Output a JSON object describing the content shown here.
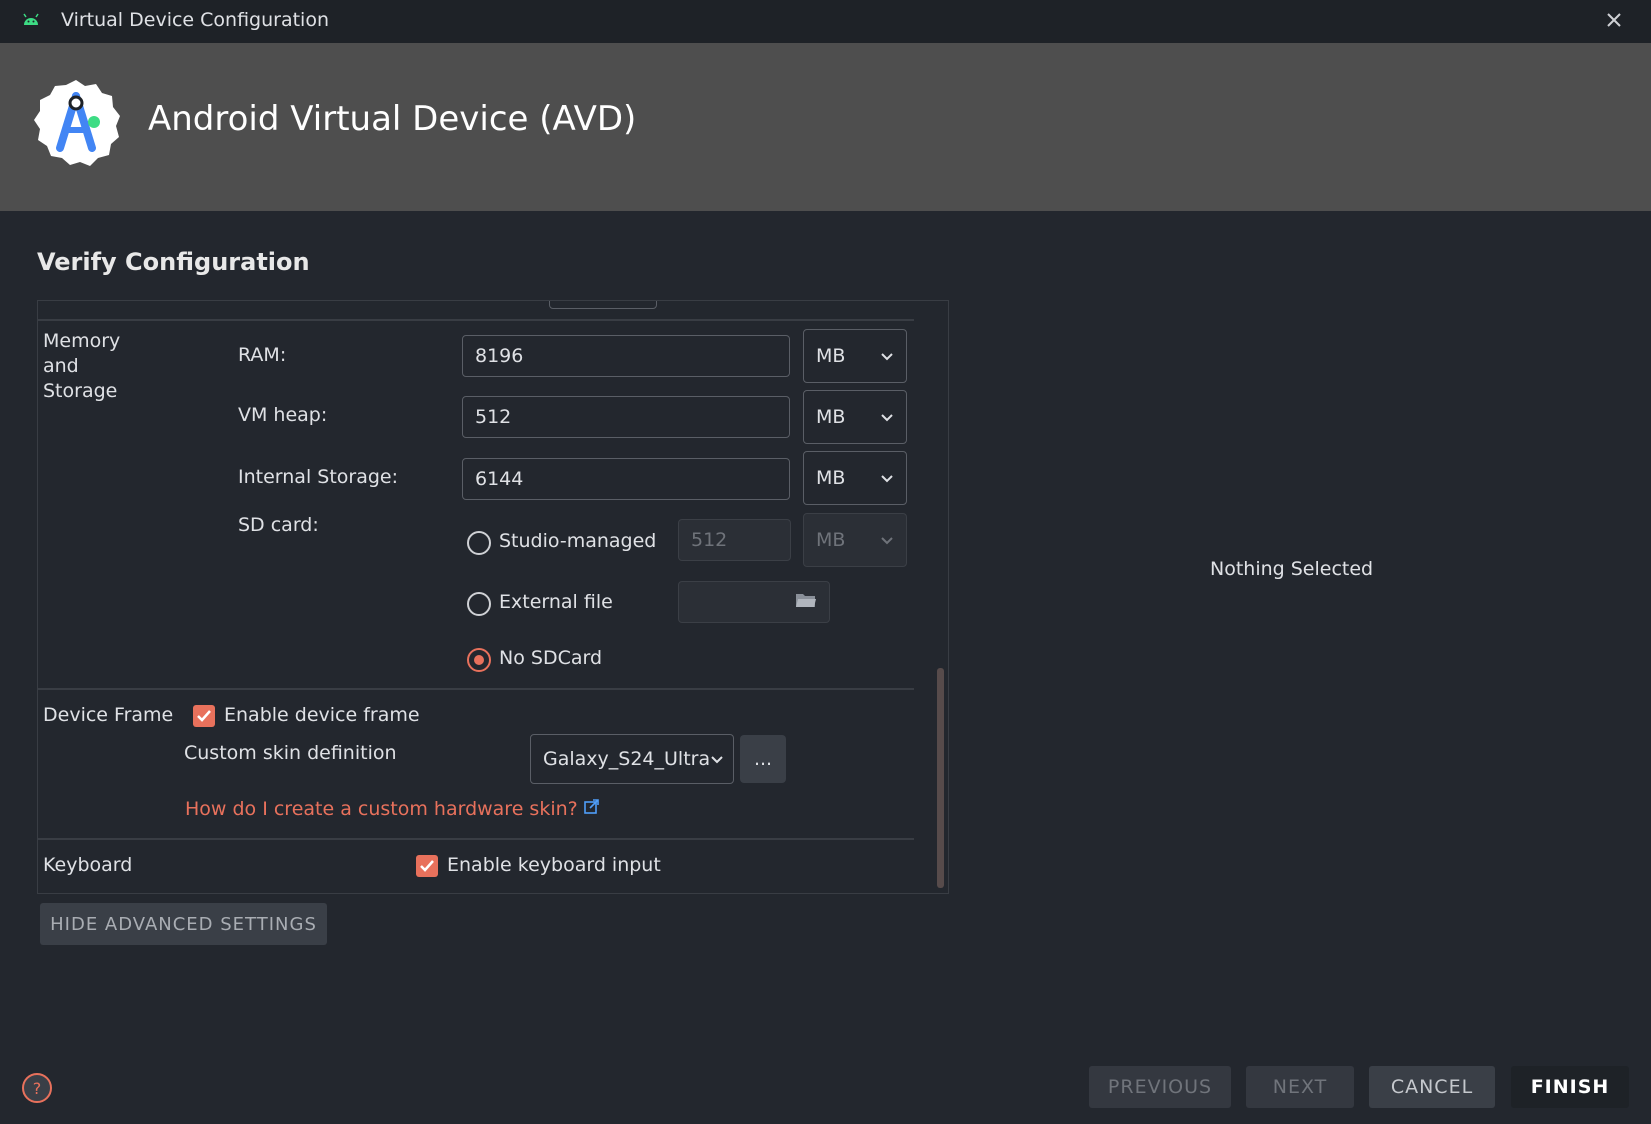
{
  "window": {
    "title": "Virtual Device Configuration"
  },
  "banner": {
    "heading": "Android Virtual Device (AVD)"
  },
  "page": {
    "section_title": "Verify Configuration"
  },
  "memory": {
    "group_label": "Memory and Storage",
    "ram_label": "RAM:",
    "ram_value": "8196",
    "ram_unit": "MB",
    "vmheap_label": "VM heap:",
    "vmheap_value": "512",
    "vmheap_unit": "MB",
    "internal_label": "Internal Storage:",
    "internal_value": "6144",
    "internal_unit": "MB",
    "sdcard_label": "SD card:",
    "studio_managed_label": "Studio-managed",
    "studio_managed_value": "512",
    "studio_managed_unit": "MB",
    "external_file_label": "External file",
    "external_file_value": "",
    "no_sdcard_label": "No SDCard",
    "selected_sd_option": "No SDCard"
  },
  "device_frame": {
    "group_label": "Device Frame",
    "enable_label": "Enable device frame",
    "enabled": true,
    "skin_label": "Custom skin definition",
    "skin_value": "Galaxy_S24_Ultra",
    "browse_label": "...",
    "help_link": "How do I create a custom hardware skin?"
  },
  "keyboard": {
    "group_label": "Keyboard",
    "enable_label": "Enable keyboard input",
    "enabled": true
  },
  "advanced": {
    "toggle_label": "HIDE ADVANCED SETTINGS"
  },
  "details": {
    "empty_text": "Nothing Selected"
  },
  "footer": {
    "previous": "PREVIOUS",
    "next": "NEXT",
    "cancel": "CANCEL",
    "finish": "FINISH"
  },
  "colors": {
    "accent": "#e8715c",
    "background": "#23272e",
    "banner": "#4e4e4e",
    "titlebar": "#1e2227"
  }
}
